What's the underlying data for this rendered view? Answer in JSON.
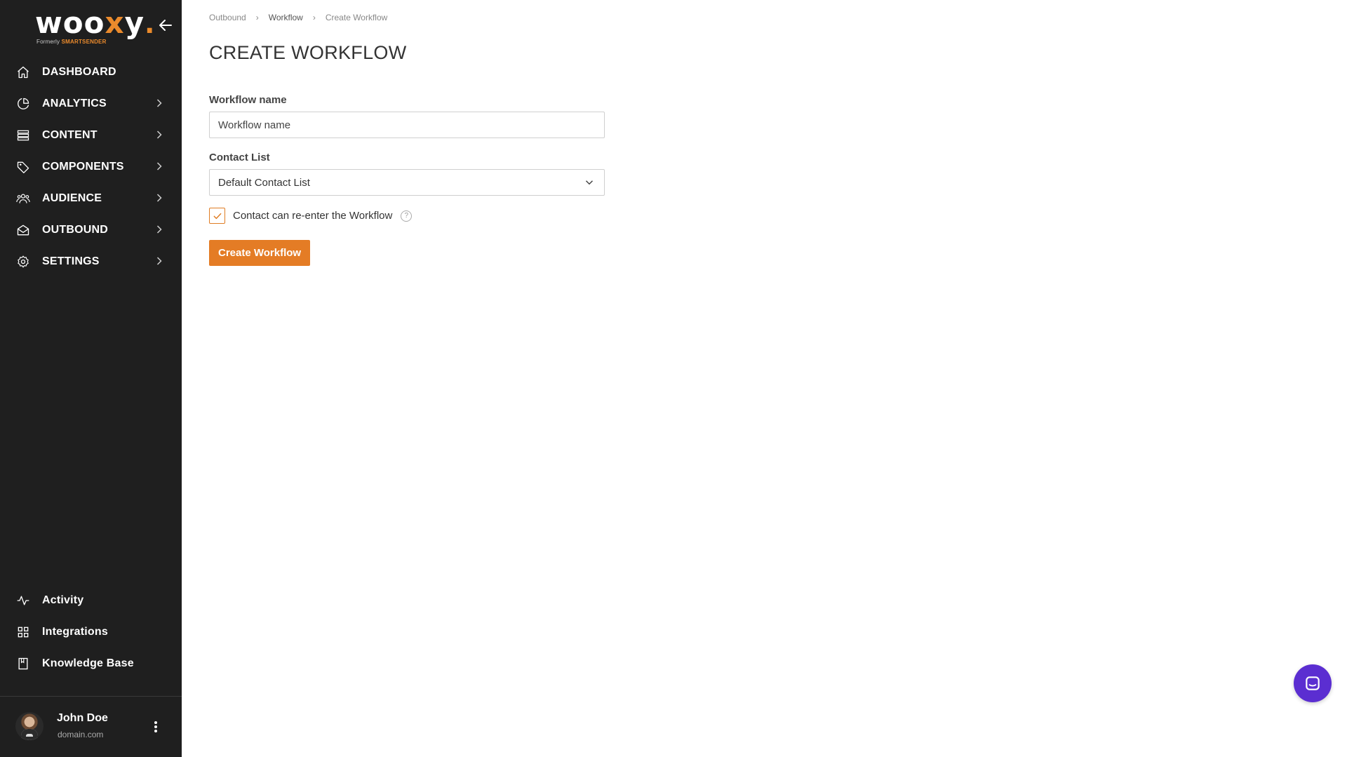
{
  "brand": {
    "logo_main": "woo",
    "logo_x": "x",
    "logo_end": "y",
    "logo_dot": ".",
    "sub_prefix": "Formerly",
    "sub_brand": "SMARTSENDER",
    "accent_color": "#ea8a2c",
    "sidebar_bg": "#1f1f1f"
  },
  "nav": {
    "items": [
      {
        "label": "DASHBOARD",
        "icon": "home-icon"
      },
      {
        "label": "ANALYTICS",
        "icon": "pie-chart-icon"
      },
      {
        "label": "CONTENT",
        "icon": "list-icon"
      },
      {
        "label": "COMPONENTS",
        "icon": "tag-icon"
      },
      {
        "label": "AUDIENCE",
        "icon": "users-icon"
      },
      {
        "label": "OUTBOUND",
        "icon": "mail-open-icon"
      },
      {
        "label": "SETTINGS",
        "icon": "gear-icon"
      }
    ],
    "bottom": [
      {
        "label": "Activity",
        "icon": "activity-icon"
      },
      {
        "label": "Integrations",
        "icon": "grid-icon"
      },
      {
        "label": "Knowledge Base",
        "icon": "book-icon"
      }
    ]
  },
  "user": {
    "name": "John Doe",
    "domain": "domain.com"
  },
  "breadcrumb": [
    "Outbound",
    "Workflow",
    "Create Workflow"
  ],
  "page": {
    "title": "CREATE WORKFLOW",
    "workflow_name_label": "Workflow name",
    "workflow_name_placeholder": "Workflow name",
    "workflow_name_value": "",
    "contact_list_label": "Contact List",
    "contact_list_value": "Default Contact List",
    "reenter_label": "Contact can re-enter the Workflow",
    "reenter_checked": true,
    "help_glyph": "?",
    "submit_label": "Create Workflow",
    "button_color": "#e47c25"
  },
  "chat": {
    "icon": "chat-icon",
    "color": "#5b2ed1"
  }
}
